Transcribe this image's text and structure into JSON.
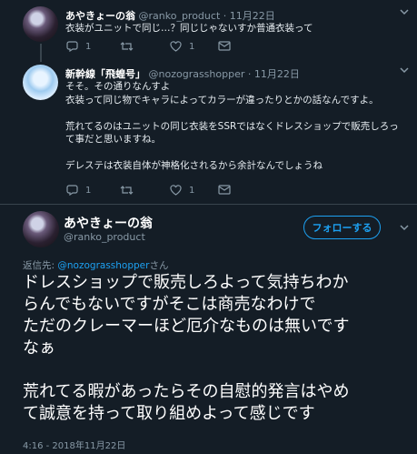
{
  "tweet1": {
    "name": "あやきょーの翁",
    "handle": "@ranko_product",
    "dot": "·",
    "date": "11月22日",
    "text": "衣装がユニットで同じ…？同じじゃないすか普通衣装って",
    "reply_count": "1",
    "retweet_count": "",
    "like_count": "1"
  },
  "tweet2": {
    "name": "新幹線「飛蝗号」",
    "handle": "@nozograsshopper",
    "dot": "·",
    "date": "11月22日",
    "text": "そそ。その通りなんすよ\n衣装って同じ物でキャラによってカラーが違ったりとかの話なんですよ。\n\n荒れてるのはユニットの同じ衣装をSSRではなくドレスショップで販売しろっ\nて事だと思いますね。\n\nデレステは衣装自体が神格化されるから余計なんでしょうね",
    "reply_count": "1",
    "retweet_count": "",
    "like_count": "1"
  },
  "main_tweet": {
    "name": "あやきょーの翁",
    "handle": "@ranko_product",
    "follow_label": "フォローする",
    "reply_prefix": "返信先: ",
    "reply_handle": "@nozograsshopper",
    "reply_suffix": "さん",
    "text": "ドレスショップで販売しろよって気持ちわか\nらんでもないですがそこは商売なわけで\nただのクレーマーほど厄介なものは無いです\nなぁ\n\n荒れてる暇があったらその自慰的発言はやめ\nて誠意を持って取り組めよって感じです",
    "timestamp": "4:16 - 2018年11月22日"
  },
  "colors": {
    "background": "#141d26",
    "accent": "#1da1f2",
    "muted": "#8899a6",
    "border": "#38444d"
  }
}
